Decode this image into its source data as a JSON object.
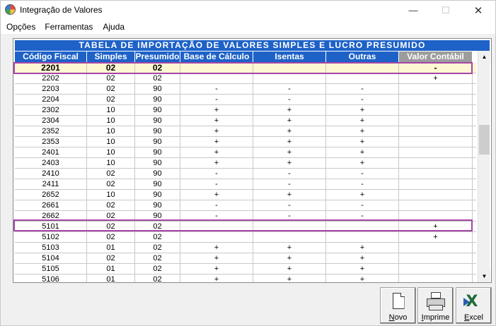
{
  "window": {
    "title": "Integração de Valores",
    "min": "—",
    "max": "☐",
    "close": "✕"
  },
  "menu": [
    "Opções",
    "Ferramentas",
    "Ajuda"
  ],
  "grid": {
    "title": "TABELA DE IMPORTAÇÃO DE VALORES SIMPLES E LUCRO PRESUMIDO",
    "columns": [
      "Código Fiscal",
      "Simples",
      "Presumido",
      "Base de Cálculo",
      "Isentas",
      "Outras",
      "Valor Contábil"
    ],
    "rows": [
      [
        "2201",
        "02",
        "02",
        "",
        "",
        "",
        "-"
      ],
      [
        "2202",
        "02",
        "02",
        "",
        "",
        "",
        "+"
      ],
      [
        "2203",
        "02",
        "90",
        "-",
        "-",
        "-",
        ""
      ],
      [
        "2204",
        "02",
        "90",
        "-",
        "-",
        "-",
        ""
      ],
      [
        "2302",
        "10",
        "90",
        "+",
        "+",
        "+",
        ""
      ],
      [
        "2304",
        "10",
        "90",
        "+",
        "+",
        "+",
        ""
      ],
      [
        "2352",
        "10",
        "90",
        "+",
        "+",
        "+",
        ""
      ],
      [
        "2353",
        "10",
        "90",
        "+",
        "+",
        "+",
        ""
      ],
      [
        "2401",
        "10",
        "90",
        "+",
        "+",
        "+",
        ""
      ],
      [
        "2403",
        "10",
        "90",
        "+",
        "+",
        "+",
        ""
      ],
      [
        "2410",
        "02",
        "90",
        "-",
        "-",
        "-",
        ""
      ],
      [
        "2411",
        "02",
        "90",
        "-",
        "-",
        "-",
        ""
      ],
      [
        "2652",
        "10",
        "90",
        "+",
        "+",
        "+",
        ""
      ],
      [
        "2661",
        "02",
        "90",
        "-",
        "-",
        "-",
        ""
      ],
      [
        "2662",
        "02",
        "90",
        "-",
        "-",
        "-",
        ""
      ],
      [
        "5101",
        "02",
        "02",
        "",
        "",
        "",
        "+"
      ],
      [
        "5102",
        "02",
        "02",
        "",
        "",
        "",
        "+"
      ],
      [
        "5103",
        "01",
        "02",
        "+",
        "+",
        "+",
        ""
      ],
      [
        "5104",
        "02",
        "02",
        "+",
        "+",
        "+",
        ""
      ],
      [
        "5105",
        "01",
        "02",
        "+",
        "+",
        "+",
        ""
      ],
      [
        "5106",
        "01",
        "02",
        "+",
        "+",
        "+",
        ""
      ]
    ]
  },
  "buttons": {
    "novo": {
      "label_underlined": "N",
      "label_rest": "ovo"
    },
    "imprime": {
      "label_underlined": "I",
      "label_rest": "mprime"
    },
    "excel": {
      "label_underlined": "E",
      "label_rest": "xcel"
    }
  },
  "colors": {
    "header_blue": "#1e62c8",
    "header_gray": "#9c9c9c",
    "selected_row": "#fff6d2",
    "highlight": "#a545a8"
  }
}
